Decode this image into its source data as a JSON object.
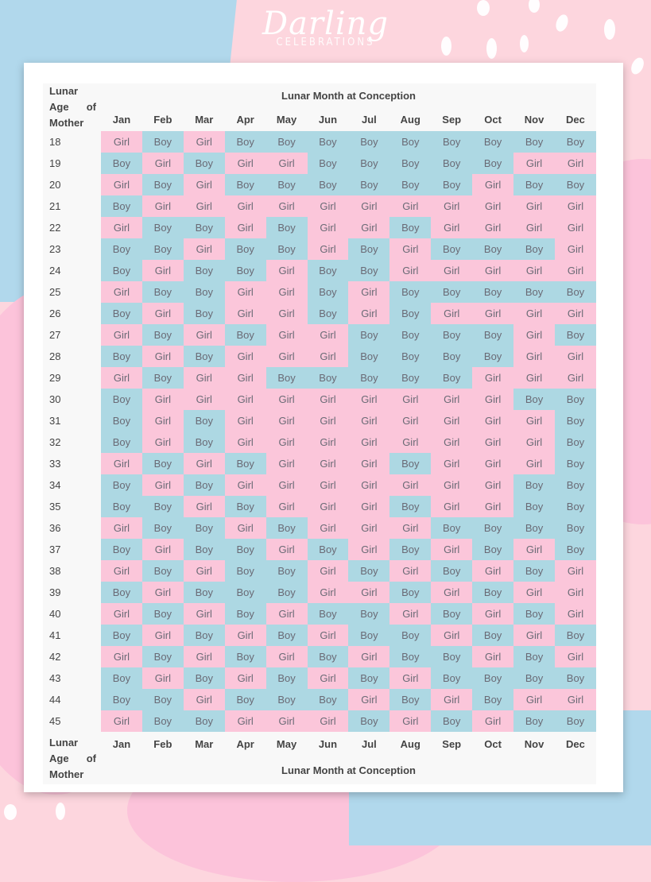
{
  "logo": {
    "main": "Darling",
    "sub": "CELEBRATIONS"
  },
  "chart_data": {
    "type": "table",
    "title": "Lunar Month at Conception",
    "row_header_label": [
      "Lunar",
      "Age",
      "of",
      "Mother"
    ],
    "column_axis_label": "Lunar Month at Conception",
    "columns": [
      "Jan",
      "Feb",
      "Mar",
      "Apr",
      "May",
      "Jun",
      "Jul",
      "Aug",
      "Sep",
      "Oct",
      "Nov",
      "Dec"
    ],
    "colors": {
      "Boy": "#add8e3",
      "Girl": "#fbc6da"
    },
    "rows": [
      {
        "age": "18",
        "values": [
          "Girl",
          "Boy",
          "Girl",
          "Boy",
          "Boy",
          "Boy",
          "Boy",
          "Boy",
          "Boy",
          "Boy",
          "Boy",
          "Boy"
        ]
      },
      {
        "age": "19",
        "values": [
          "Boy",
          "Girl",
          "Boy",
          "Girl",
          "Girl",
          "Boy",
          "Boy",
          "Boy",
          "Boy",
          "Boy",
          "Girl",
          "Girl"
        ]
      },
      {
        "age": "20",
        "values": [
          "Girl",
          "Boy",
          "Girl",
          "Boy",
          "Boy",
          "Boy",
          "Boy",
          "Boy",
          "Boy",
          "Girl",
          "Boy",
          "Boy"
        ]
      },
      {
        "age": "21",
        "values": [
          "Boy",
          "Girl",
          "Girl",
          "Girl",
          "Girl",
          "Girl",
          "Girl",
          "Girl",
          "Girl",
          "Girl",
          "Girl",
          "Girl"
        ]
      },
      {
        "age": "22",
        "values": [
          "Girl",
          "Boy",
          "Boy",
          "Girl",
          "Boy",
          "Girl",
          "Girl",
          "Boy",
          "Girl",
          "Girl",
          "Girl",
          "Girl"
        ]
      },
      {
        "age": "23",
        "values": [
          "Boy",
          "Boy",
          "Girl",
          "Boy",
          "Boy",
          "Girl",
          "Boy",
          "Girl",
          "Boy",
          "Boy",
          "Boy",
          "Girl"
        ]
      },
      {
        "age": "24",
        "values": [
          "Boy",
          "Girl",
          "Boy",
          "Boy",
          "Girl",
          "Boy",
          "Boy",
          "Girl",
          "Girl",
          "Girl",
          "Girl",
          "Girl"
        ]
      },
      {
        "age": "25",
        "values": [
          "Girl",
          "Boy",
          "Boy",
          "Girl",
          "Girl",
          "Boy",
          "Girl",
          "Boy",
          "Boy",
          "Boy",
          "Boy",
          "Boy"
        ]
      },
      {
        "age": "26",
        "values": [
          "Boy",
          "Girl",
          "Boy",
          "Girl",
          "Girl",
          "Boy",
          "Girl",
          "Boy",
          "Girl",
          "Girl",
          "Girl",
          "Girl"
        ]
      },
      {
        "age": "27",
        "values": [
          "Girl",
          "Boy",
          "Girl",
          "Boy",
          "Girl",
          "Girl",
          "Boy",
          "Boy",
          "Boy",
          "Boy",
          "Girl",
          "Boy"
        ]
      },
      {
        "age": "28",
        "values": [
          "Boy",
          "Girl",
          "Boy",
          "Girl",
          "Girl",
          "Girl",
          "Boy",
          "Boy",
          "Boy",
          "Boy",
          "Girl",
          "Girl"
        ]
      },
      {
        "age": "29",
        "values": [
          "Girl",
          "Boy",
          "Girl",
          "Girl",
          "Boy",
          "Boy",
          "Boy",
          "Boy",
          "Boy",
          "Girl",
          "Girl",
          "Girl"
        ]
      },
      {
        "age": "30",
        "values": [
          "Boy",
          "Girl",
          "Girl",
          "Girl",
          "Girl",
          "Girl",
          "Girl",
          "Girl",
          "Girl",
          "Girl",
          "Boy",
          "Boy"
        ]
      },
      {
        "age": "31",
        "values": [
          "Boy",
          "Girl",
          "Boy",
          "Girl",
          "Girl",
          "Girl",
          "Girl",
          "Girl",
          "Girl",
          "Girl",
          "Girl",
          "Boy"
        ]
      },
      {
        "age": "32",
        "values": [
          "Boy",
          "Girl",
          "Boy",
          "Girl",
          "Girl",
          "Girl",
          "Girl",
          "Girl",
          "Girl",
          "Girl",
          "Girl",
          "Boy"
        ]
      },
      {
        "age": "33",
        "values": [
          "Girl",
          "Boy",
          "Girl",
          "Boy",
          "Girl",
          "Girl",
          "Girl",
          "Boy",
          "Girl",
          "Girl",
          "Girl",
          "Boy"
        ]
      },
      {
        "age": "34",
        "values": [
          "Boy",
          "Girl",
          "Boy",
          "Girl",
          "Girl",
          "Girl",
          "Girl",
          "Girl",
          "Girl",
          "Girl",
          "Boy",
          "Boy"
        ]
      },
      {
        "age": "35",
        "values": [
          "Boy",
          "Boy",
          "Girl",
          "Boy",
          "Girl",
          "Girl",
          "Girl",
          "Boy",
          "Girl",
          "Girl",
          "Boy",
          "Boy"
        ]
      },
      {
        "age": "36",
        "values": [
          "Girl",
          "Boy",
          "Boy",
          "Girl",
          "Boy",
          "Girl",
          "Girl",
          "Girl",
          "Boy",
          "Boy",
          "Boy",
          "Boy"
        ]
      },
      {
        "age": "37",
        "values": [
          "Boy",
          "Girl",
          "Boy",
          "Boy",
          "Girl",
          "Boy",
          "Girl",
          "Boy",
          "Girl",
          "Boy",
          "Girl",
          "Boy"
        ]
      },
      {
        "age": "38",
        "values": [
          "Girl",
          "Boy",
          "Girl",
          "Boy",
          "Boy",
          "Girl",
          "Boy",
          "Girl",
          "Boy",
          "Girl",
          "Boy",
          "Girl"
        ]
      },
      {
        "age": "39",
        "values": [
          "Boy",
          "Girl",
          "Boy",
          "Boy",
          "Boy",
          "Girl",
          "Girl",
          "Boy",
          "Girl",
          "Boy",
          "Girl",
          "Girl"
        ]
      },
      {
        "age": "40",
        "values": [
          "Girl",
          "Boy",
          "Girl",
          "Boy",
          "Girl",
          "Boy",
          "Boy",
          "Girl",
          "Boy",
          "Girl",
          "Boy",
          "Girl"
        ]
      },
      {
        "age": "41",
        "values": [
          "Boy",
          "Girl",
          "Boy",
          "Girl",
          "Boy",
          "Girl",
          "Boy",
          "Boy",
          "Girl",
          "Boy",
          "Girl",
          "Boy"
        ]
      },
      {
        "age": "42",
        "values": [
          "Girl",
          "Boy",
          "Girl",
          "Boy",
          "Girl",
          "Boy",
          "Girl",
          "Boy",
          "Boy",
          "Girl",
          "Boy",
          "Girl"
        ]
      },
      {
        "age": "43",
        "values": [
          "Boy",
          "Girl",
          "Boy",
          "Girl",
          "Boy",
          "Girl",
          "Boy",
          "Girl",
          "Boy",
          "Boy",
          "Boy",
          "Boy"
        ]
      },
      {
        "age": "44",
        "values": [
          "Boy",
          "Boy",
          "Girl",
          "Boy",
          "Boy",
          "Boy",
          "Girl",
          "Boy",
          "Girl",
          "Boy",
          "Girl",
          "Girl"
        ]
      },
      {
        "age": "45",
        "values": [
          "Girl",
          "Boy",
          "Boy",
          "Girl",
          "Girl",
          "Girl",
          "Boy",
          "Girl",
          "Boy",
          "Girl",
          "Boy",
          "Boy"
        ]
      }
    ]
  }
}
